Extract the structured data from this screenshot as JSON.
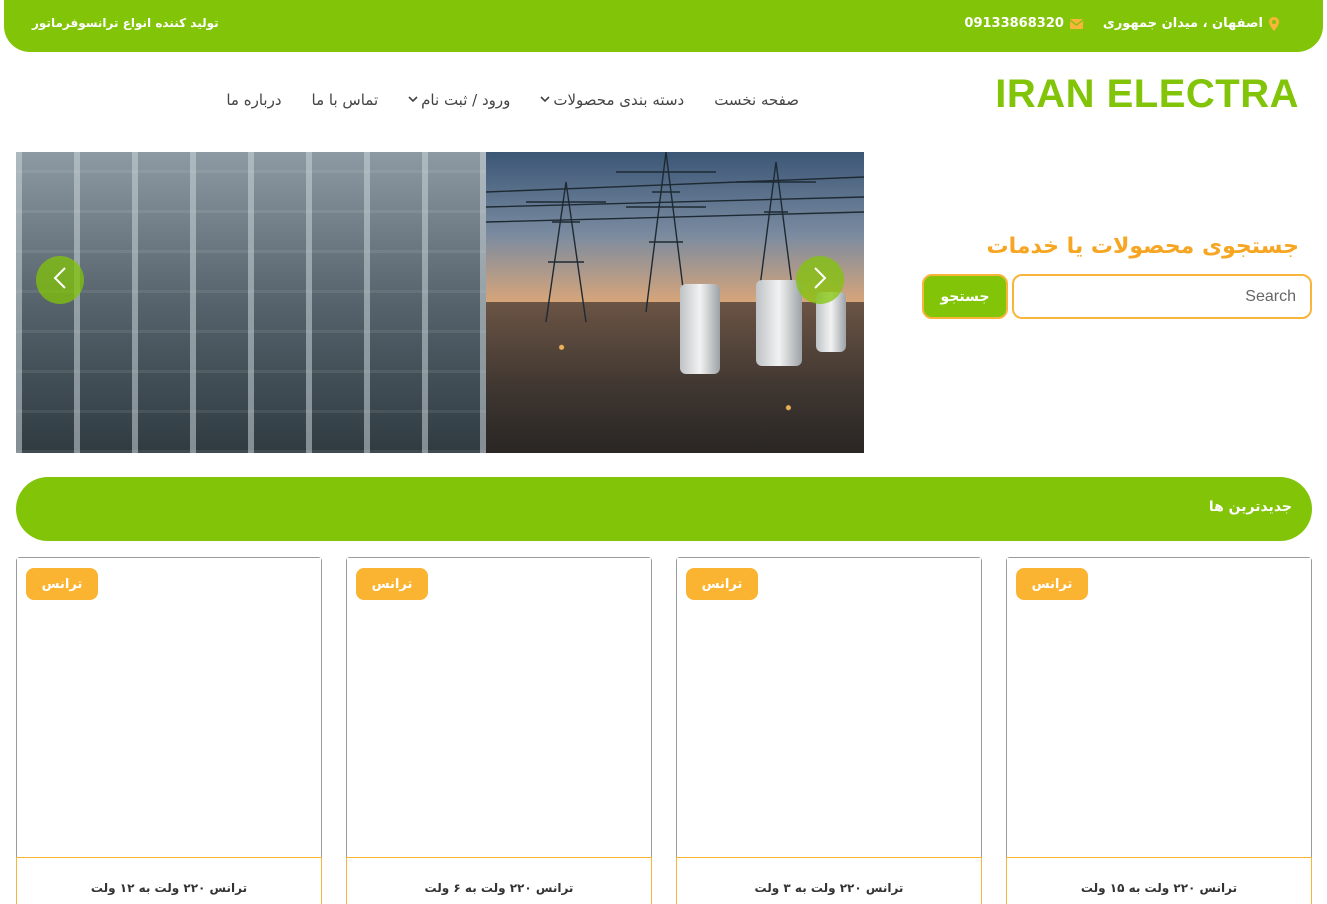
{
  "topbar": {
    "tagline": "تولید کننده انواع ترانسوفرماتور",
    "phone": "09133868320",
    "address": "اصفهان ، میدان جمهوری"
  },
  "header": {
    "logo": "IRAN ELECTRA",
    "nav": [
      {
        "label": "صفحه نخست",
        "dropdown": false
      },
      {
        "label": "دسته بندی محصولات",
        "dropdown": true
      },
      {
        "label": "ورود / ثبت نام",
        "dropdown": true
      },
      {
        "label": "تماس با ما",
        "dropdown": false
      },
      {
        "label": "درباره ما",
        "dropdown": false
      }
    ]
  },
  "search": {
    "title": "جستجوی محصولات یا خدمات",
    "placeholder": "Search",
    "button": "جستجو"
  },
  "section": {
    "title": "جدیدترین ها"
  },
  "products": [
    {
      "badge": "ترانس",
      "name": "ترانس ۲۲۰ ولت به ۱۵ ولت"
    },
    {
      "badge": "ترانس",
      "name": "ترانس ۲۲۰ ولت به ۳ ولت"
    },
    {
      "badge": "ترانس",
      "name": "ترانس ۲۲۰ ولت به ۶ ولت"
    },
    {
      "badge": "ترانس",
      "name": "ترانس ۲۲۰ ولت به ۱۲ ولت"
    }
  ],
  "colors": {
    "brand_green": "#82c408",
    "accent_orange": "#f9b43a",
    "title_orange": "#f6a623"
  },
  "icons": {
    "phone": "envelope-icon",
    "address": "map-marker-icon",
    "slider_prev": "chevron-left-icon",
    "slider_next": "chevron-right-icon"
  }
}
